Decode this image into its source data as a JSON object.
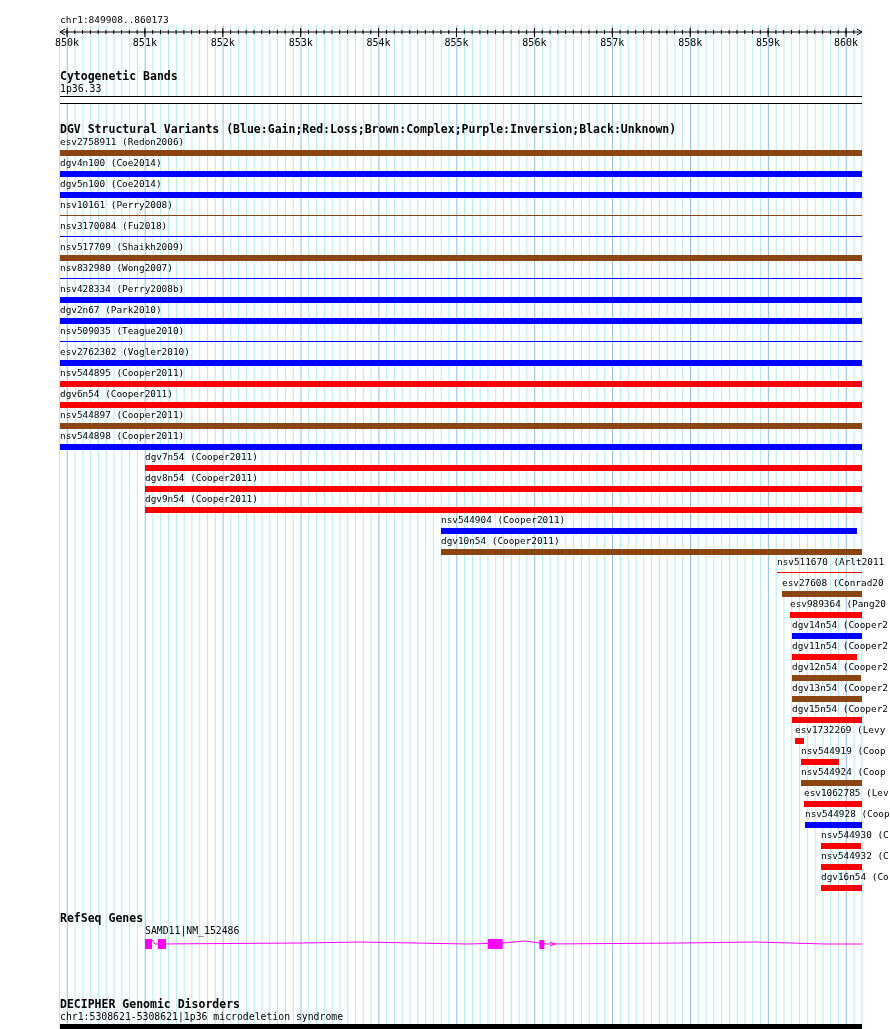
{
  "ruler": {
    "label": "chr1:849908..860173",
    "ticks": [
      "850k",
      "851k",
      "852k",
      "853k",
      "854k",
      "855k",
      "856k",
      "857k",
      "858k",
      "859k",
      "860k"
    ]
  },
  "cytogenetic_bands": {
    "title": "Cytogenetic Bands",
    "band": "1p36.33"
  },
  "dgv": {
    "title": "DGV Structural Variants (Blue:Gain;Red:Loss;Brown:Complex;Purple:Inversion;Black:Unknown)",
    "variants": [
      {
        "label": "esv2758911 (Redon2006)",
        "kind": "thick",
        "color": "#8b4513"
      },
      {
        "label": "dgv4n100 (Coe2014)",
        "kind": "thick",
        "color": "#0000ff"
      },
      {
        "label": "dgv5n100 (Coe2014)",
        "kind": "thick",
        "color": "#0000ff"
      },
      {
        "label": "nsv10161 (Perry2008)",
        "kind": "thin",
        "color": "#8b4513"
      },
      {
        "label": "nsv3170084 (Fu2018)",
        "kind": "thin",
        "color": "#0000ff"
      },
      {
        "label": "nsv517709 (Shaikh2009)",
        "kind": "thick",
        "color": "#8b4513"
      },
      {
        "label": "nsv832980 (Wong2007)",
        "kind": "thin",
        "color": "#0000ff"
      },
      {
        "label": "nsv428334 (Perry2008b)",
        "kind": "thick",
        "color": "#0000ff"
      },
      {
        "label": "dgv2n67 (Park2010)",
        "kind": "thick",
        "color": "#0000ff"
      },
      {
        "label": "nsv509035 (Teague2010)",
        "kind": "thin",
        "color": "#0000ff"
      },
      {
        "label": "esv2762302 (Vogler2010)",
        "kind": "thick",
        "color": "#0000ff"
      },
      {
        "label": "nsv544895 (Cooper2011)",
        "kind": "thick",
        "color": "#ff0000"
      },
      {
        "label": "dgv6n54 (Cooper2011)",
        "kind": "thick",
        "color": "#ff0000"
      },
      {
        "label": "nsv544897 (Cooper2011)",
        "kind": "thick",
        "color": "#8b4513"
      },
      {
        "label": "nsv544898 (Cooper2011)",
        "kind": "thick",
        "color": "#0000ff"
      },
      {
        "label": "dgv7n54 (Cooper2011)",
        "kind": "thick",
        "color": "#ff0000"
      },
      {
        "label": "dgv8n54 (Cooper2011)",
        "kind": "thick",
        "color": "#ff0000"
      },
      {
        "label": "dgv9n54 (Cooper2011)",
        "kind": "thick",
        "color": "#ff0000"
      },
      {
        "label": "nsv544904 (Cooper2011)",
        "kind": "thick",
        "color": "#0000ff"
      },
      {
        "label": "dgv10n54 (Cooper2011)",
        "kind": "thick",
        "color": "#8b4513"
      },
      {
        "label": "nsv511670 (Arlt2011",
        "kind": "thin",
        "color": "#ff0000"
      },
      {
        "label": "esv27608 (Conrad20",
        "kind": "thick",
        "color": "#8b4513"
      },
      {
        "label": "esv989364 (Pang20",
        "kind": "thick",
        "color": "#ff0000"
      },
      {
        "label": "dgv14n54 (Cooper2",
        "kind": "thick",
        "color": "#0000ff"
      },
      {
        "label": "dgv11n54 (Cooper2",
        "kind": "thick",
        "color": "#ff0000"
      },
      {
        "label": "dgv12n54 (Cooper2",
        "kind": "thick",
        "color": "#8b4513"
      },
      {
        "label": "dgv13n54 (Cooper2",
        "kind": "thick",
        "color": "#8b4513"
      },
      {
        "label": "dgv15n54 (Cooper2",
        "kind": "thick",
        "color": "#ff0000"
      },
      {
        "label": "esv1732269 (Levy",
        "kind": "thick",
        "color": "#ff0000"
      },
      {
        "label": "nsv544919 (Coop",
        "kind": "thick",
        "color": "#ff0000"
      },
      {
        "label": "nsv544924 (Coop",
        "kind": "thick",
        "color": "#8b4513"
      },
      {
        "label": "esv1062785 (Lev",
        "kind": "thick",
        "color": "#ff0000"
      },
      {
        "label": "nsv544928 (Coop",
        "kind": "thick",
        "color": "#0000ff"
      },
      {
        "label": "nsv544930 (C",
        "kind": "thick",
        "color": "#ff0000"
      },
      {
        "label": "nsv544932 (C",
        "kind": "thick",
        "color": "#ff0000"
      },
      {
        "label": "dgv16n54 (Co",
        "kind": "thick",
        "color": "#ff0000"
      }
    ]
  },
  "refseq": {
    "title": "RefSeq Genes",
    "gene": {
      "label": "SAMD11|NM_152486"
    }
  },
  "decipher": {
    "title": "DECIPHER Genomic Disorders",
    "region": "chr1:5308621-5308621|1p36 microdeletion syndrome"
  }
}
